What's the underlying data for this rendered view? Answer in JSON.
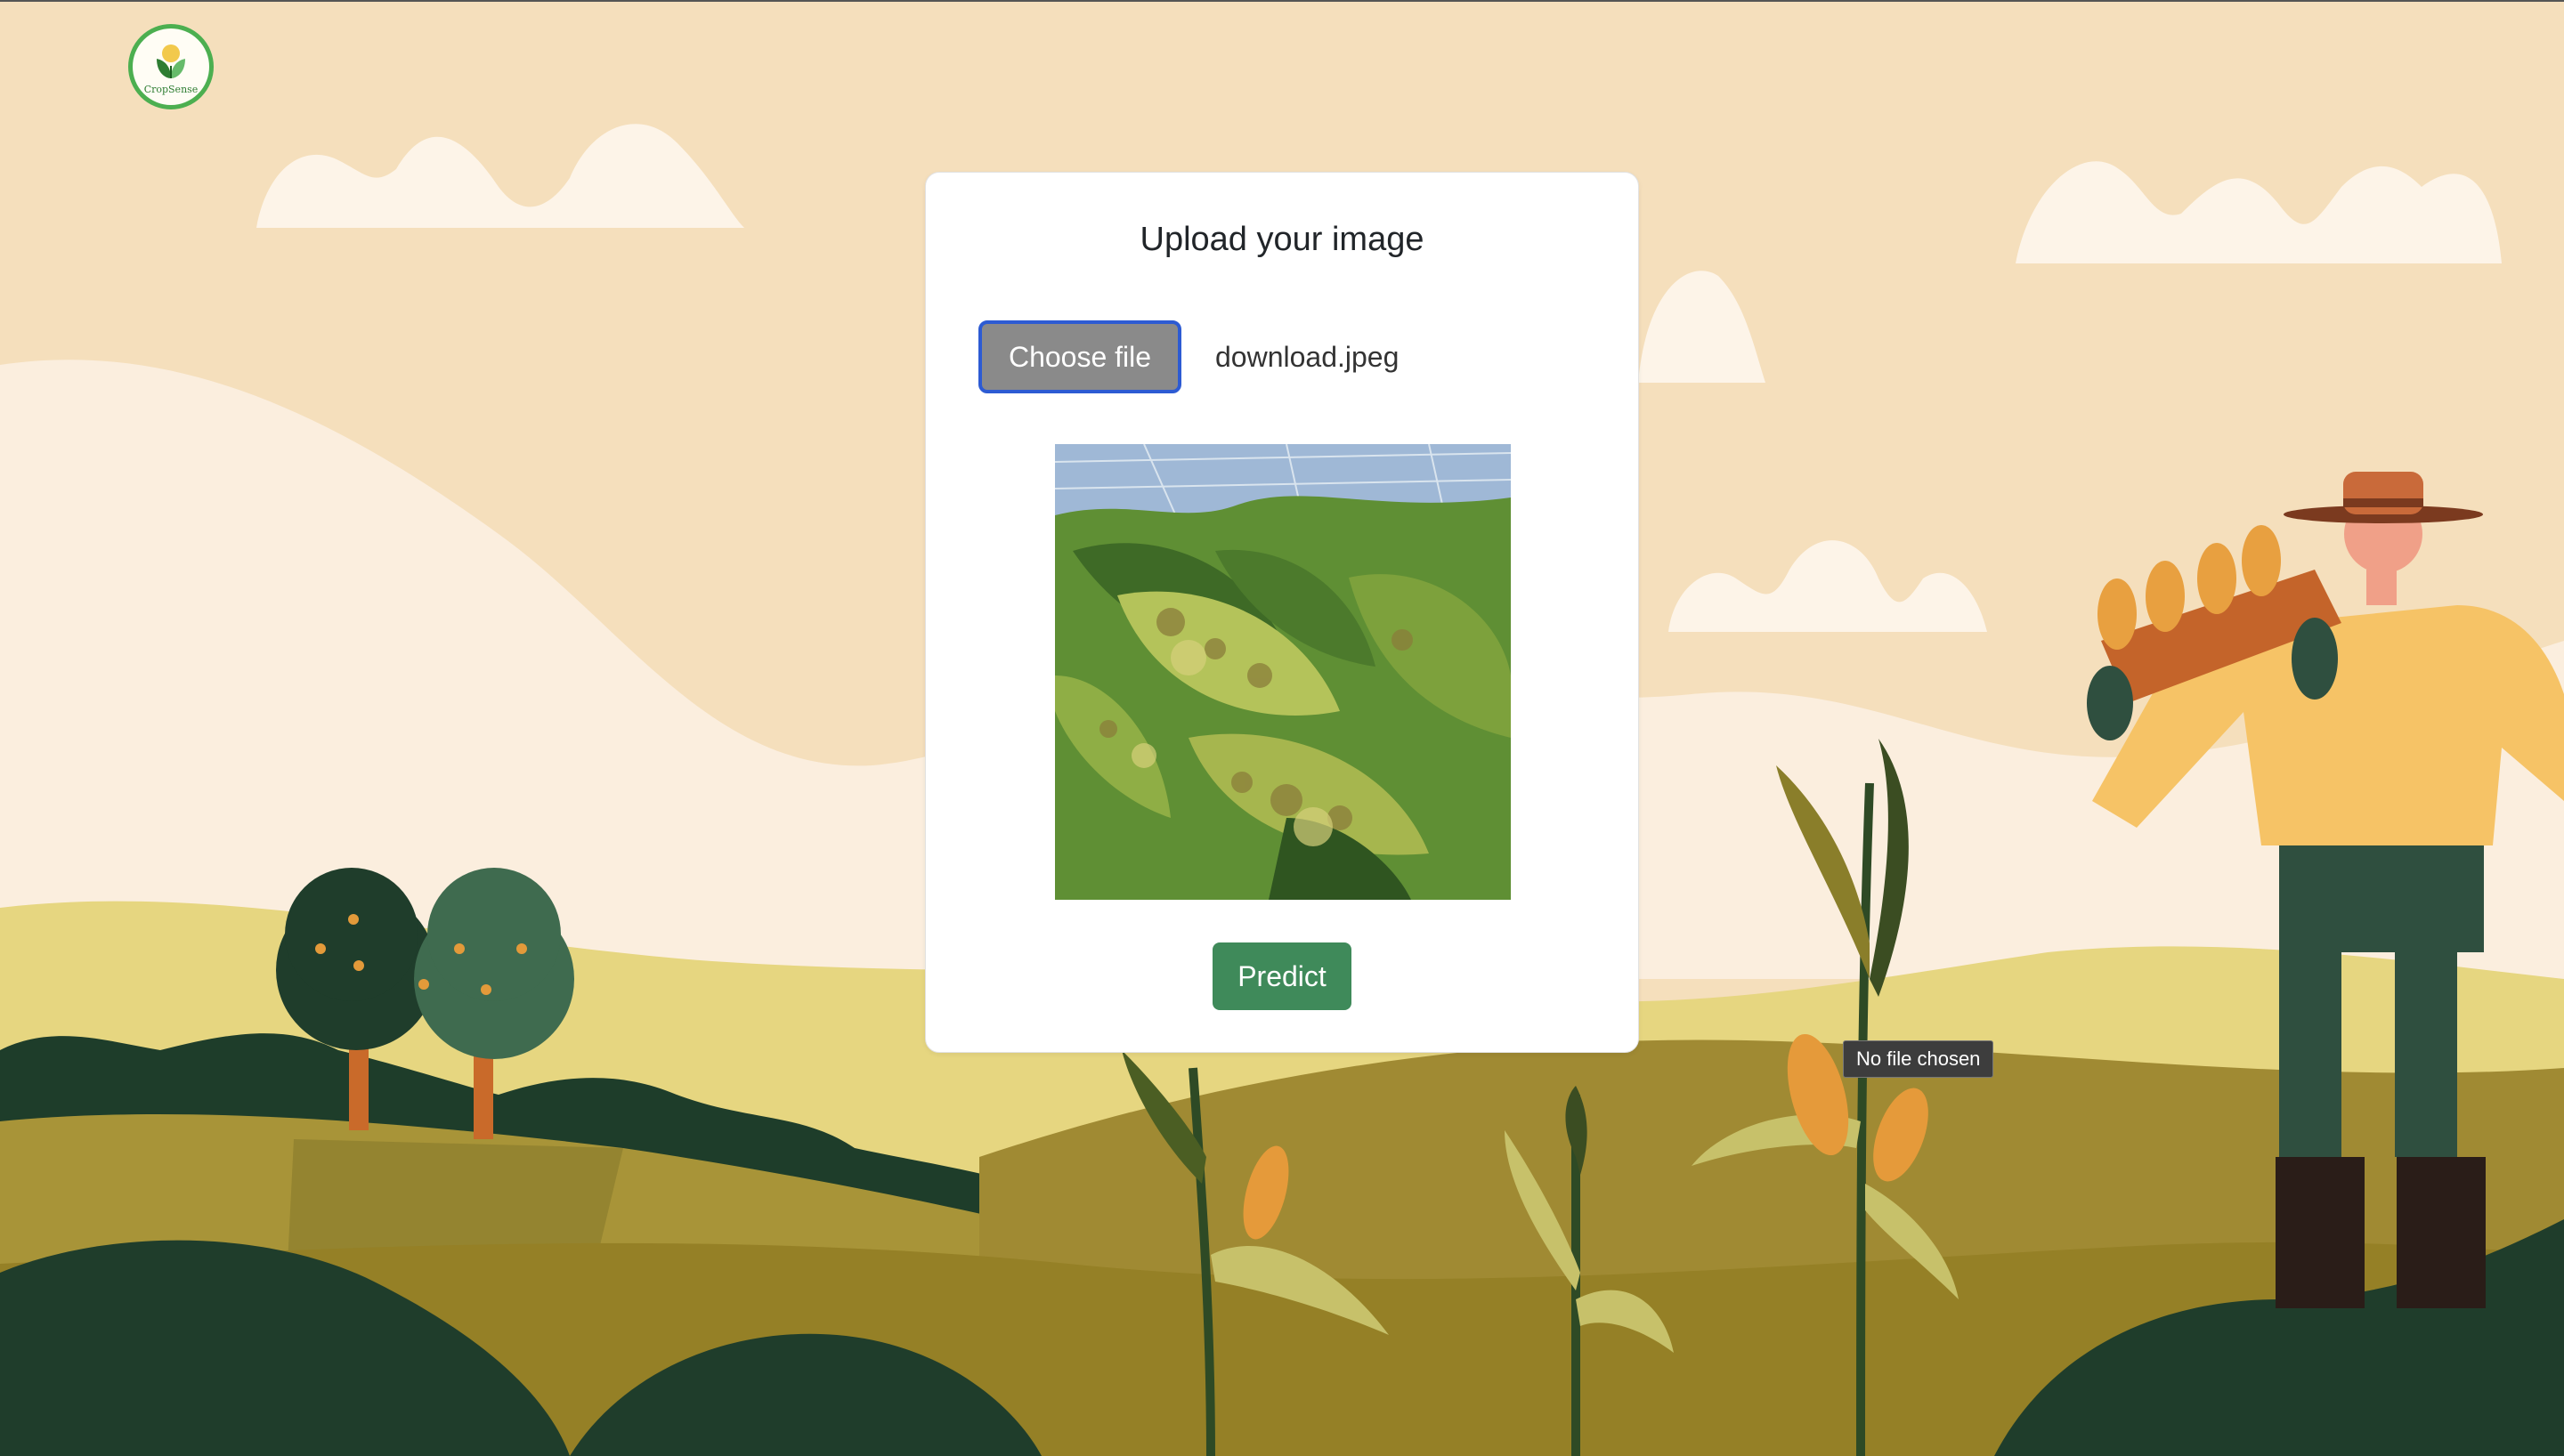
{
  "logo": {
    "text": "CropSense"
  },
  "upload_card": {
    "title": "Upload your image",
    "choose_file_label": "Choose file",
    "selected_file_name": "download.jpeg",
    "predict_label": "Predict"
  },
  "tooltip": {
    "text": "No file chosen"
  },
  "colors": {
    "background": "#f5dfbc",
    "choose_button_bg": "#8a8a8a",
    "choose_button_focus_border": "#2d5bd3",
    "predict_button_bg": "#3f8a5a",
    "logo_ring": "#4caf50"
  },
  "icons": {
    "logo": "leaf-logo-icon"
  }
}
